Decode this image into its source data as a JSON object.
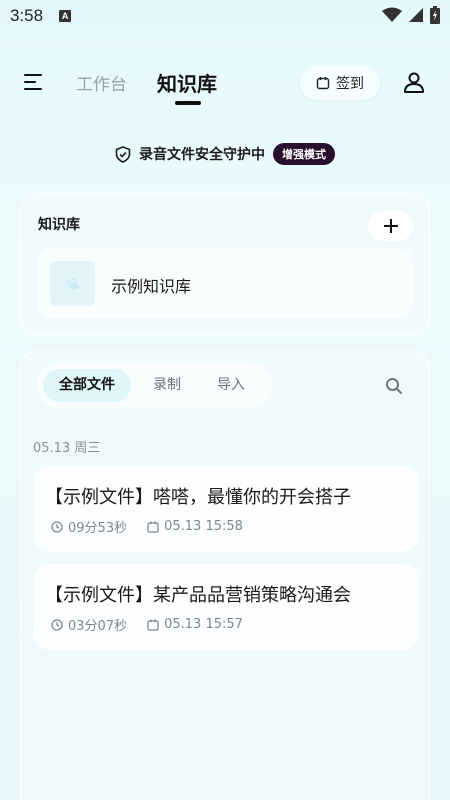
{
  "status_bar": {
    "time": "3:58",
    "a_icon_label": "A"
  },
  "nav": {
    "tab_work": "工作台",
    "tab_knowledge": "知识库",
    "checkin_label": "签到"
  },
  "security": {
    "text": "录音文件安全守护中",
    "badge": "增强模式"
  },
  "knowledge_base": {
    "title": "知识库",
    "items": [
      {
        "label": "示例知识库"
      }
    ]
  },
  "files": {
    "segments": [
      "全部文件",
      "录制",
      "导入"
    ],
    "active_segment": "全部文件",
    "groups": [
      {
        "date": "05.13 周三",
        "items": [
          {
            "title": "【示例文件】嗒嗒，最懂你的开会搭子",
            "duration": "09分53秒",
            "datetime": "05.13 15:58"
          },
          {
            "title": "【示例文件】某产品品营销策略沟通会",
            "duration": "03分07秒",
            "datetime": "05.13 15:57"
          }
        ]
      }
    ]
  },
  "colors": {
    "accent_badge": "#2a0f2c",
    "active_segment_bg": "#dff5f9",
    "background": "#e4f8fb"
  }
}
